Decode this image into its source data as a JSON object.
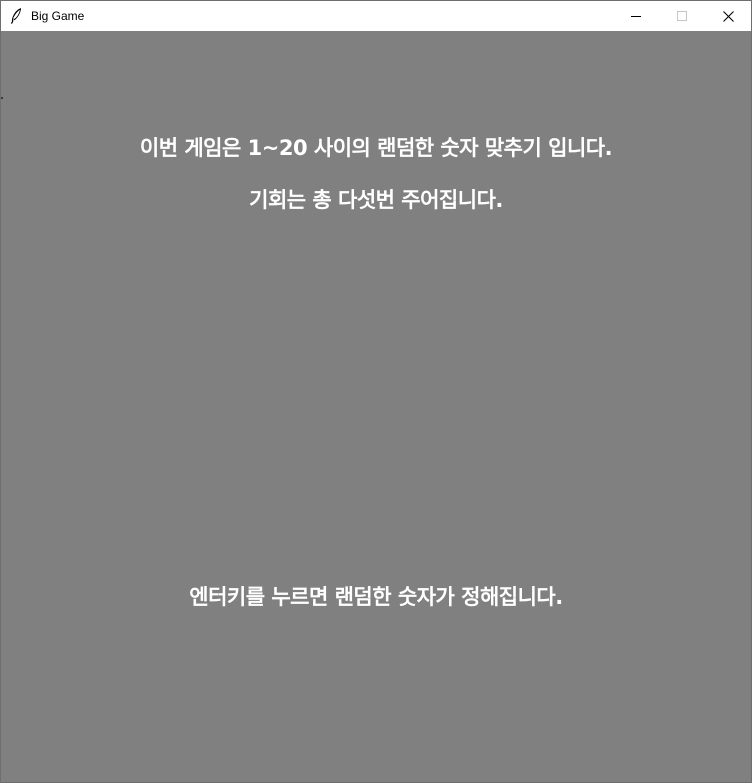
{
  "window": {
    "title": "Big Game",
    "icon": "feather-icon",
    "controls": [
      "minimize-icon",
      "maximize-icon",
      "close-icon"
    ],
    "background": "#808080"
  },
  "game": {
    "intro_line": "이번 게임은 1~20 사이의 랜덤한 숫자 맞추기 입니다.",
    "chances_line": "기회는 총 다섯번 주어집니다.",
    "prompt_line": "엔터키를 누르면 랜덤한 숫자가 정해집니다.",
    "text_color": "#ffffff"
  }
}
